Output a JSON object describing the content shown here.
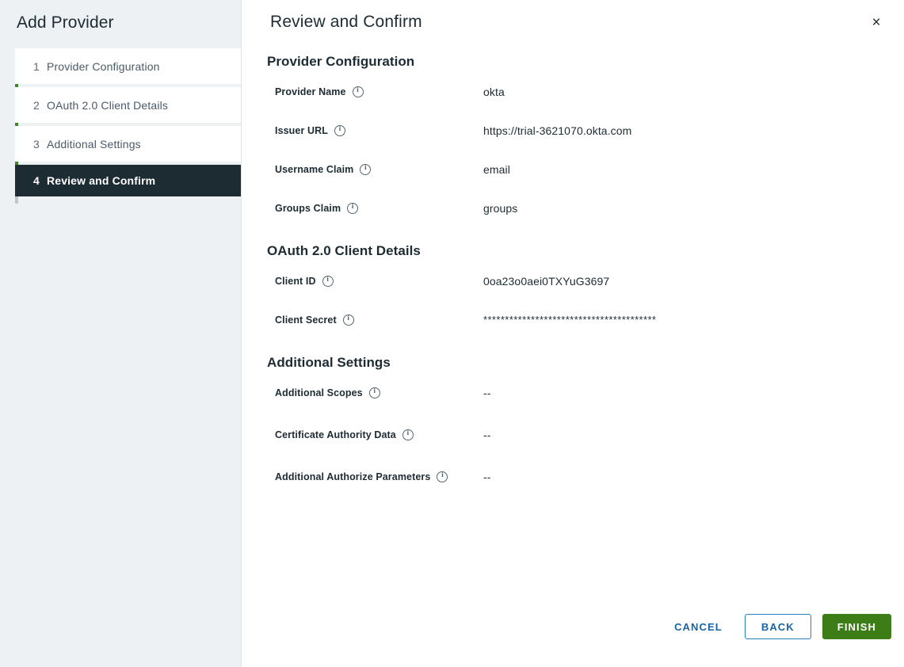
{
  "sidebar": {
    "title": "Add Provider",
    "steps": [
      {
        "num": "1",
        "label": "Provider Configuration",
        "state": "done"
      },
      {
        "num": "2",
        "label": "OAuth 2.0 Client Details",
        "state": "done"
      },
      {
        "num": "3",
        "label": "Additional Settings",
        "state": "done"
      },
      {
        "num": "4",
        "label": "Review and Confirm",
        "state": "current"
      }
    ]
  },
  "header": {
    "title": "Review and Confirm",
    "close_label": "×"
  },
  "sections": [
    {
      "title": "Provider Configuration",
      "fields": [
        {
          "label": "Provider Name",
          "info": "info-icon",
          "value": "okta"
        },
        {
          "label": "Issuer URL",
          "info": "info-icon",
          "value": "https://trial-3621070.okta.com"
        },
        {
          "label": "Username Claim",
          "info": "info-icon",
          "value": "email"
        },
        {
          "label": "Groups Claim",
          "info": "info-icon",
          "value": "groups"
        }
      ]
    },
    {
      "title": "OAuth 2.0 Client Details",
      "fields": [
        {
          "label": "Client ID",
          "info": "info-icon",
          "value": "0oa23o0aei0TXYuG3697"
        },
        {
          "label": "Client Secret",
          "info": "info-icon",
          "value": "****************************************"
        }
      ]
    },
    {
      "title": "Additional Settings",
      "fields": [
        {
          "label": "Additional Scopes",
          "info": "info-icon",
          "value": "--"
        },
        {
          "label": "Certificate Authority Data",
          "info": "info-icon",
          "value": "--"
        },
        {
          "label": "Additional Authorize Parameters",
          "info": "info-icon",
          "value": "--"
        }
      ]
    }
  ],
  "footer": {
    "cancel_label": "CANCEL",
    "back_label": "BACK",
    "finish_label": "FINISH"
  },
  "colors": {
    "accent_done": "#3c8a27",
    "accent_current": "#bcc7cf",
    "sidebar_bg": "#edf1f4",
    "selected_bg": "#1d2b33",
    "link_blue": "#1964a5",
    "primary_green": "#3c7d18"
  }
}
